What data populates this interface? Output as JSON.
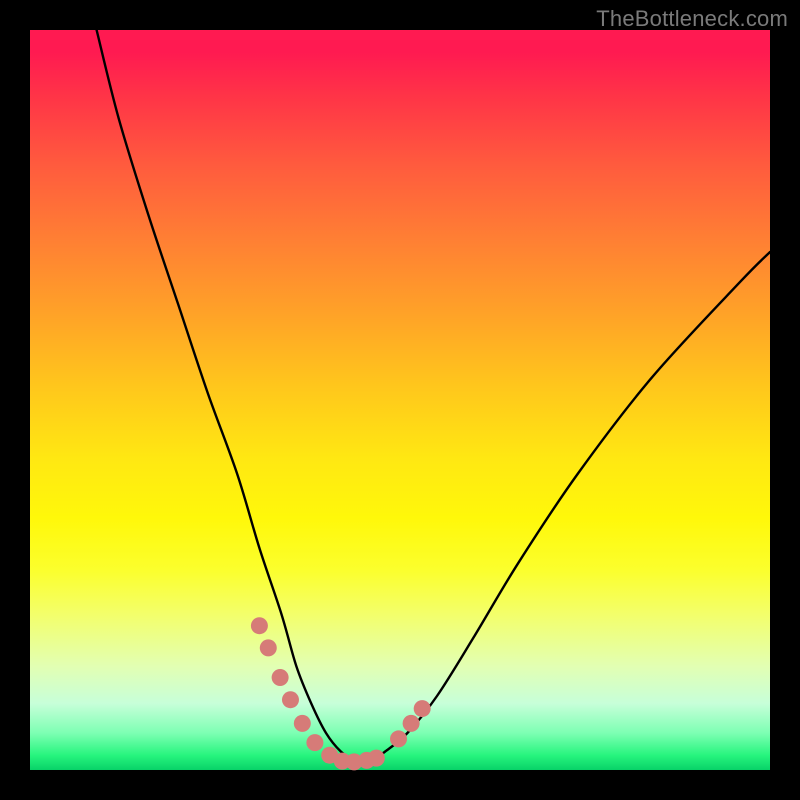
{
  "attribution": "TheBottleneck.com",
  "chart_data": {
    "type": "line",
    "title": "",
    "xlabel": "",
    "ylabel": "",
    "xlim": [
      0,
      100
    ],
    "ylim": [
      0,
      100
    ],
    "grid": false,
    "legend": false,
    "gradient_stops": [
      {
        "y": 100,
        "color": "#ff1a51"
      },
      {
        "y": 60,
        "color": "#ffa128"
      },
      {
        "y": 35,
        "color": "#fff80a"
      },
      {
        "y": 10,
        "color": "#c7ffd9"
      },
      {
        "y": 0,
        "color": "#08d268"
      }
    ],
    "series": [
      {
        "name": "bottleneck-curve",
        "color": "#000000",
        "x": [
          9,
          12,
          16,
          20,
          24,
          28,
          31,
          34,
          36,
          38,
          40,
          42,
          44,
          46,
          48,
          51,
          55,
          60,
          66,
          74,
          84,
          96,
          100
        ],
        "values": [
          100,
          88,
          75,
          63,
          51,
          40,
          30,
          21,
          14,
          9,
          5,
          2.5,
          1.2,
          1.2,
          2.5,
          5,
          10,
          18,
          28,
          40,
          53,
          66,
          70
        ]
      },
      {
        "name": "points-left-arm",
        "type": "scatter",
        "color": "#d67b78",
        "x": [
          31.0,
          32.2,
          33.8,
          35.2,
          36.8,
          38.5,
          40.5,
          42.2
        ],
        "values": [
          19.5,
          16.5,
          12.5,
          9.5,
          6.3,
          3.7,
          2.0,
          1.2
        ]
      },
      {
        "name": "points-valley",
        "type": "scatter",
        "color": "#d67b78",
        "x": [
          43.8,
          45.5,
          46.8
        ],
        "values": [
          1.1,
          1.3,
          1.6
        ]
      },
      {
        "name": "points-right-arm",
        "type": "scatter",
        "color": "#d67b78",
        "x": [
          49.8,
          51.5,
          53.0
        ],
        "values": [
          4.2,
          6.3,
          8.3
        ]
      }
    ]
  }
}
